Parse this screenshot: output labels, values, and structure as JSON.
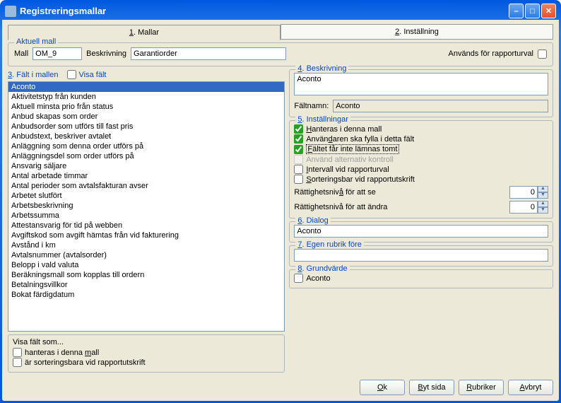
{
  "window": {
    "title": "Registreringsmallar"
  },
  "tabs": {
    "t1_num": "1",
    "t1_label": ". Mallar",
    "t2_num": "2",
    "t2_label": ". Inställning"
  },
  "aktuell_mall": {
    "legend": "Aktuell mall",
    "mall_label": "Mall",
    "mall_value": "OM_9",
    "beskrivning_label": "Beskrivning",
    "beskrivning_value": "Garantiorder",
    "anv_rapport_label": "Används för rapporturval"
  },
  "left": {
    "section_num": "3",
    "section_label": ". Fält i mallen",
    "visa_falt_label": "Visa fält",
    "items": [
      "Aconto",
      "Aktivitetstyp från kunden",
      "Aktuell minsta prio från status",
      "Anbud skapas som order",
      "Anbudsorder som utförs till fast pris",
      "Anbudstext, beskriver avtalet",
      "Anläggning som denna order utförs på",
      "Anläggningsdel som order utförs på",
      "Ansvarig säljare",
      "Antal arbetade timmar",
      "Antal perioder som avtalsfakturan avser",
      "Arbetet slutfört",
      "Arbetsbeskrivning",
      "Arbetssumma",
      "Attestansvarig för tid på webben",
      "Avgiftskod som avgift hämtas från vid fakturering",
      "Avstånd i km",
      "Avtalsnummer (avtalsorder)",
      "Belopp i vald valuta",
      "Beräkningsmall som kopplas till ordern",
      "Betalningsvillkor",
      "Bokat färdigdatum"
    ],
    "filter_title": "Visa fält som...",
    "filter_hanteras": "hanteras i denna ",
    "filter_hanteras_u": "m",
    "filter_hanteras_end": "all",
    "filter_sort": "är sorteringsbara vid rapportutskrift"
  },
  "right": {
    "beskrivning": {
      "num": "4",
      "legend": ". Beskrivning",
      "value": "Aconto",
      "faltnamn_label": "Fältnamn:",
      "faltnamn_value": "Aconto"
    },
    "inst": {
      "num": "5",
      "legend": ". Inställningar",
      "c1_pre": "",
      "c1_u": "H",
      "c1_post": "anteras i denna mall",
      "c2_pre": "Använ",
      "c2_u": "d",
      "c2_post": "aren ska fylla i detta fält",
      "c3_pre": "",
      "c3_u": "F",
      "c3_post": "ältet får inte lämnas tomt",
      "c4": "Använd alternativ kontroll",
      "c5_pre": "",
      "c5_u": "I",
      "c5_post": "ntervall vid rapporturval",
      "c6_pre": "",
      "c6_u": "S",
      "c6_post": "orteringsbar vid rapportutskrift",
      "r_se_pre": "Rättighetsniv",
      "r_se_u": "å",
      "r_se_post": " för att se",
      "r_andra": "Rättighetsnivå för att ändra",
      "val_se": "0",
      "val_andra": "0"
    },
    "dialog": {
      "num": "6",
      "legend": ". Dialog",
      "value": "Aconto"
    },
    "rubrik": {
      "num": "7",
      "legend": ". Egen rubrik före",
      "value": ""
    },
    "grund": {
      "num": "8",
      "legend": ". Grundvärde",
      "cb_label": "Aconto"
    }
  },
  "footer": {
    "ok_u": "O",
    "ok_post": "k",
    "byt_u": "B",
    "byt_post": "yt sida",
    "rubr_u": "R",
    "rubr_post": "ubriker",
    "avb_u": "A",
    "avb_post": "vbryt"
  }
}
